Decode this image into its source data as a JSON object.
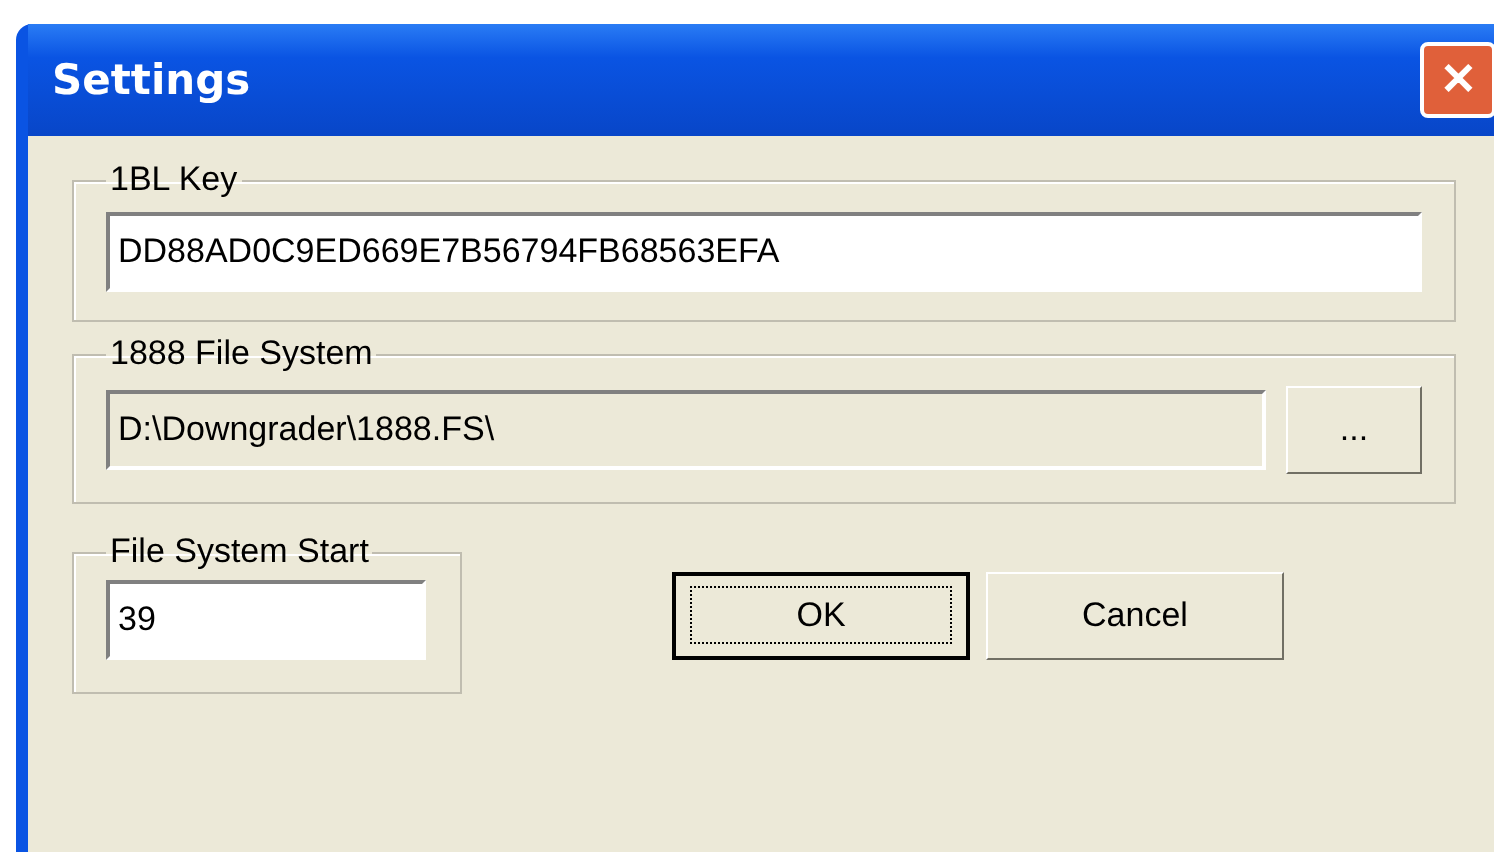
{
  "window": {
    "title": "Settings",
    "close_label": "✕"
  },
  "groups": [
    {
      "kind": "text",
      "title": "1BL Key",
      "value": "DD88AD0C9ED669E7B56794FB68563EFA",
      "readonly": false
    },
    {
      "kind": "browse",
      "title": "1888 File System",
      "value": "D:\\Downgrader\\1888.FS\\",
      "readonly": true,
      "browse_label": "..."
    }
  ],
  "start": {
    "title": "File System Start",
    "value": "39",
    "readonly": false
  },
  "buttons": [
    {
      "label": "OK",
      "default": true
    },
    {
      "label": "Cancel",
      "default": false
    }
  ]
}
